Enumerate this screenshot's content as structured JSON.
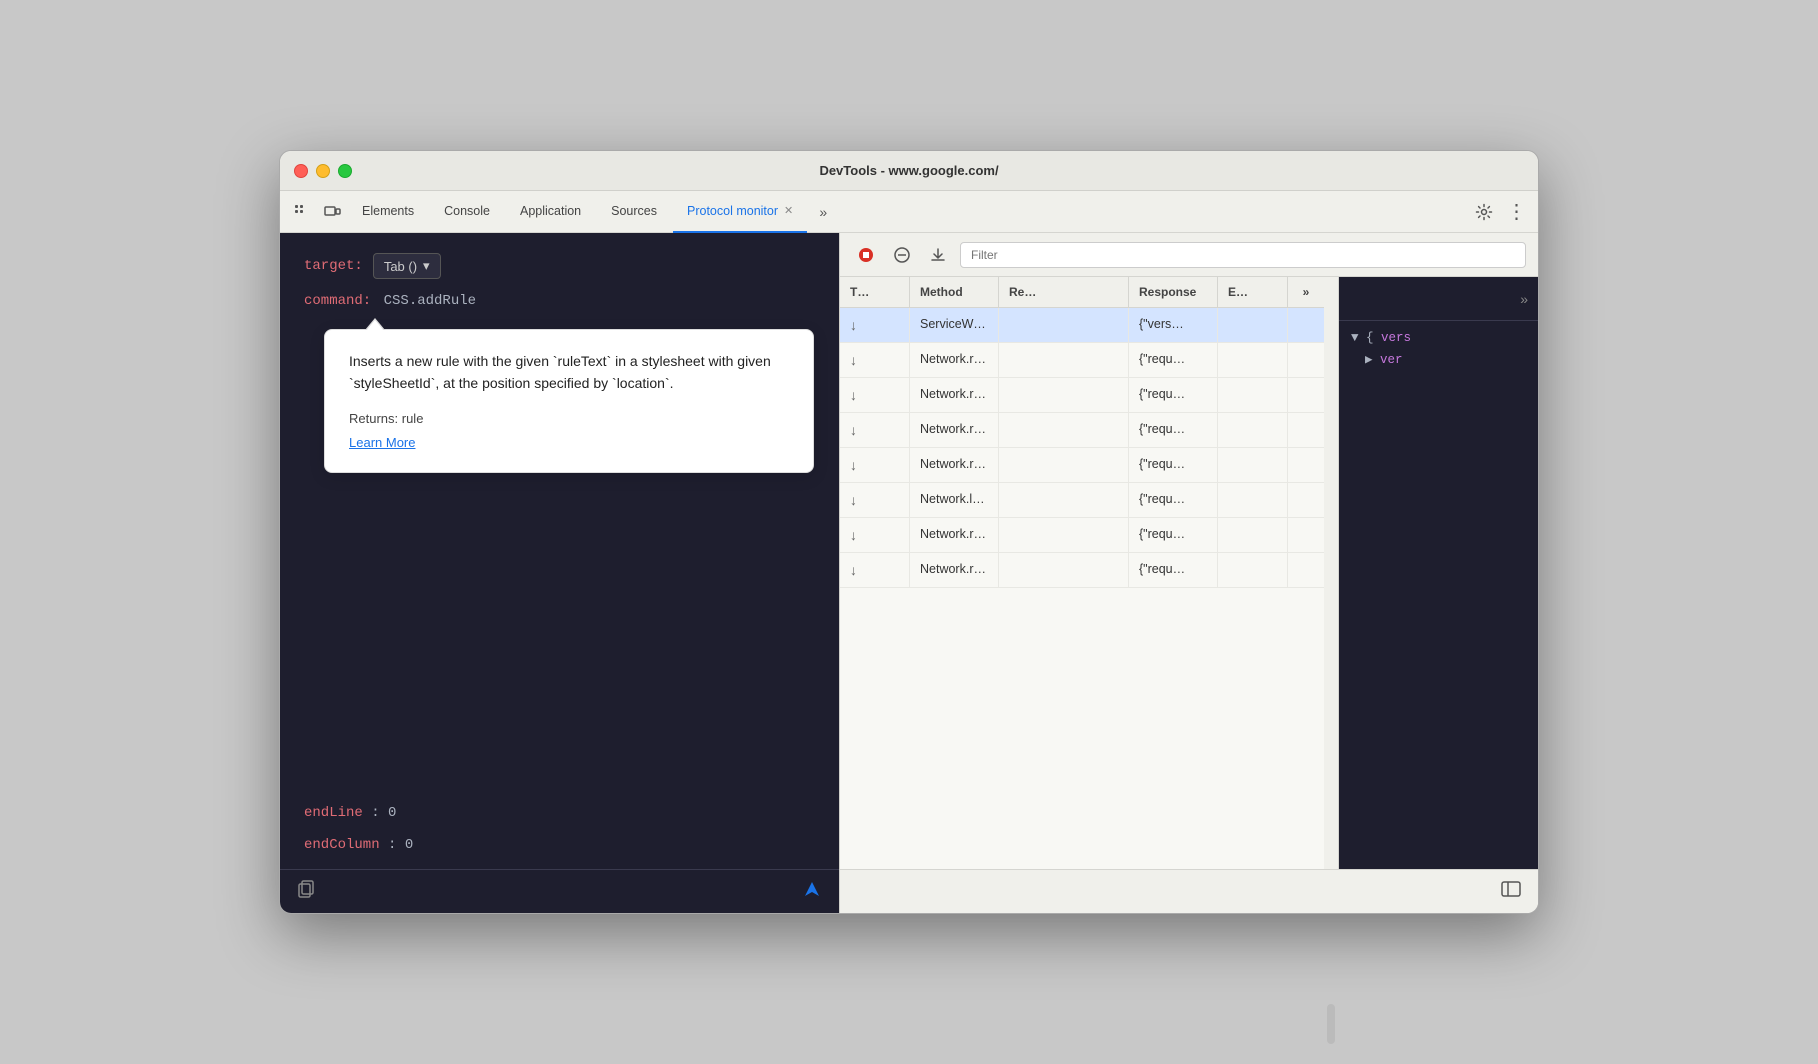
{
  "window": {
    "title": "DevTools - www.google.com/"
  },
  "tabs": [
    {
      "id": "cursor",
      "label": "⊹",
      "type": "icon"
    },
    {
      "id": "device",
      "label": "⬜",
      "type": "icon"
    },
    {
      "id": "elements",
      "label": "Elements",
      "active": false
    },
    {
      "id": "console",
      "label": "Console",
      "active": false
    },
    {
      "id": "application",
      "label": "Application",
      "active": false
    },
    {
      "id": "sources",
      "label": "Sources",
      "active": false
    },
    {
      "id": "protocol-monitor",
      "label": "Protocol monitor",
      "active": true
    },
    {
      "id": "more-tabs",
      "label": "»",
      "type": "icon"
    }
  ],
  "toolbar": {
    "settings_label": "⚙",
    "more_label": "⋮"
  },
  "left_panel": {
    "target_label": "target:",
    "dropdown_text": "Tab ()",
    "command_label": "command:",
    "command_value": "CSS.addRule",
    "tooltip": {
      "description": "Inserts a new rule with the given `ruleText` in a stylesheet with given `styleSheetId`, at the position specified by `location`.",
      "returns_label": "Returns: rule",
      "learn_more": "Learn More"
    },
    "params": [
      {
        "key": "endLine",
        "value": ": 0"
      },
      {
        "key": "endColumn",
        "value": ": 0"
      }
    ]
  },
  "right_panel": {
    "filter_placeholder": "Filter",
    "columns": [
      {
        "id": "type",
        "label": "T…"
      },
      {
        "id": "method",
        "label": "Method"
      },
      {
        "id": "request",
        "label": "Re…"
      },
      {
        "id": "response",
        "label": "Response"
      },
      {
        "id": "elapsed",
        "label": "E…"
      }
    ],
    "rows": [
      {
        "type": "↓",
        "method": "ServiceWo…",
        "request": "",
        "response": "{\"vers…",
        "elapsed": "",
        "selected": true
      },
      {
        "type": "↓",
        "method": "Network.re…",
        "request": "",
        "response": "{\"requ…",
        "elapsed": ""
      },
      {
        "type": "↓",
        "method": "Network.re…",
        "request": "",
        "response": "{\"requ…",
        "elapsed": ""
      },
      {
        "type": "↓",
        "method": "Network.re…",
        "request": "",
        "response": "{\"requ…",
        "elapsed": ""
      },
      {
        "type": "↓",
        "method": "Network.re…",
        "request": "",
        "response": "{\"requ…",
        "elapsed": ""
      },
      {
        "type": "↓",
        "method": "Network.lo…",
        "request": "",
        "response": "{\"requ…",
        "elapsed": ""
      },
      {
        "type": "↓",
        "method": "Network.re…",
        "request": "",
        "response": "{\"requ…",
        "elapsed": ""
      },
      {
        "type": "↓",
        "method": "Network.re…",
        "request": "",
        "response": "{\"requ…",
        "elapsed": ""
      }
    ]
  },
  "side_panel": {
    "content_line1": "▼ {vers",
    "content_line2": "▶ ver"
  },
  "colors": {
    "accent": "#1a73e8",
    "red_label": "#e06c75",
    "code_text": "#abb2bf",
    "selected_row": "#d4e4ff"
  }
}
